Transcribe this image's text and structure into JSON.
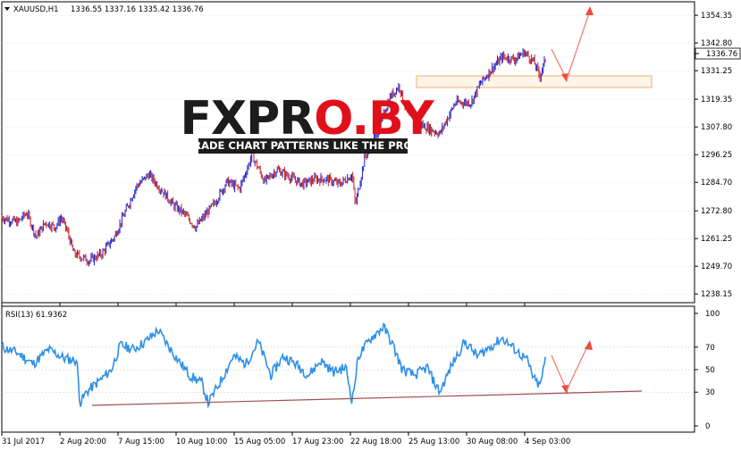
{
  "header": {
    "symbol": "XAUUSD,H1",
    "ohlc": "1336.55 1337.16 1335.42 1336.76",
    "current_price": "1336.76"
  },
  "watermark": {
    "name": "FXPRO.BY",
    "tagline": "TRADE CHART PATTERNS LIKE THE PROS"
  },
  "chart_data": [
    {
      "type": "candlestick",
      "title": "XAUUSD,H1",
      "ylim": [
        1236,
        1357
      ],
      "y_ticks": [
        "1354.35",
        "1342.80",
        "1331.25",
        "1319.35",
        "1307.80",
        "1296.25",
        "1284.70",
        "1272.80",
        "1261.25",
        "1249.70",
        "1238.15"
      ],
      "x_ticks": [
        "31 Jul 2017",
        "2 Aug 20:00",
        "7 Aug 15:00",
        "10 Aug 10:00",
        "15 Aug 05:00",
        "17 Aug 23:00",
        "22 Aug 18:00",
        "25 Aug 13:00",
        "30 Aug 08:00",
        "4 Sep 03:00"
      ],
      "close_path": [
        [
          0,
          1270
        ],
        [
          0.05,
          1268
        ],
        [
          0.08,
          1272
        ],
        [
          0.11,
          1262
        ],
        [
          0.14,
          1268
        ],
        [
          0.17,
          1266
        ],
        [
          0.19,
          1270
        ],
        [
          0.21,
          1264
        ],
        [
          0.23,
          1255
        ],
        [
          0.28,
          1252
        ],
        [
          0.32,
          1255
        ],
        [
          0.36,
          1262
        ],
        [
          0.4,
          1274
        ],
        [
          0.43,
          1283
        ],
        [
          0.47,
          1288
        ],
        [
          0.52,
          1280
        ],
        [
          0.55,
          1275
        ],
        [
          0.58,
          1272
        ],
        [
          0.62,
          1266
        ],
        [
          0.68,
          1276
        ],
        [
          0.72,
          1285
        ],
        [
          0.76,
          1282
        ],
        [
          0.8,
          1296
        ],
        [
          0.84,
          1285
        ],
        [
          0.88,
          1290
        ],
        [
          0.92,
          1287
        ],
        [
          0.96,
          1284
        ],
        [
          1.0,
          1286
        ],
        [
          1.04,
          1286
        ],
        [
          1.08,
          1284
        ],
        [
          1.12,
          1288
        ],
        [
          1.13,
          1275
        ],
        [
          1.16,
          1295
        ],
        [
          1.2,
          1305
        ],
        [
          1.24,
          1320
        ],
        [
          1.27,
          1325
        ],
        [
          1.3,
          1312
        ],
        [
          1.35,
          1308
        ],
        [
          1.4,
          1305
        ],
        [
          1.45,
          1318
        ],
        [
          1.5,
          1318
        ],
        [
          1.53,
          1326
        ],
        [
          1.56,
          1331
        ],
        [
          1.6,
          1337
        ],
        [
          1.64,
          1336
        ],
        [
          1.67,
          1339
        ],
        [
          1.7,
          1335
        ],
        [
          1.72,
          1329
        ],
        [
          1.74,
          1337
        ]
      ],
      "annotations": {
        "zone_price_range": [
          1323.5,
          1326.5
        ],
        "arrow_down_to": 1325,
        "arrow_up_to": 1354
      }
    },
    {
      "type": "line",
      "title": "RSI(13) 61.9362",
      "series": [
        {
          "name": "RSI(13)",
          "values": []
        }
      ],
      "ylim": [
        0,
        100
      ],
      "y_ticks": [
        "100",
        "70",
        "50",
        "30",
        "0"
      ],
      "rsi_path": [
        [
          0,
          70
        ],
        [
          0.05,
          65
        ],
        [
          0.1,
          55
        ],
        [
          0.15,
          68
        ],
        [
          0.2,
          60
        ],
        [
          0.24,
          58
        ],
        [
          0.25,
          20
        ],
        [
          0.27,
          30
        ],
        [
          0.32,
          42
        ],
        [
          0.35,
          50
        ],
        [
          0.38,
          72
        ],
        [
          0.42,
          68
        ],
        [
          0.46,
          75
        ],
        [
          0.5,
          85
        ],
        [
          0.53,
          72
        ],
        [
          0.56,
          60
        ],
        [
          0.6,
          45
        ],
        [
          0.64,
          38
        ],
        [
          0.66,
          20
        ],
        [
          0.7,
          40
        ],
        [
          0.74,
          62
        ],
        [
          0.78,
          55
        ],
        [
          0.82,
          75
        ],
        [
          0.86,
          45
        ],
        [
          0.9,
          62
        ],
        [
          0.94,
          55
        ],
        [
          0.98,
          45
        ],
        [
          1.02,
          58
        ],
        [
          1.06,
          48
        ],
        [
          1.1,
          52
        ],
        [
          1.12,
          22
        ],
        [
          1.14,
          62
        ],
        [
          1.18,
          78
        ],
        [
          1.22,
          88
        ],
        [
          1.25,
          72
        ],
        [
          1.28,
          50
        ],
        [
          1.32,
          45
        ],
        [
          1.36,
          52
        ],
        [
          1.38,
          40
        ],
        [
          1.4,
          30
        ],
        [
          1.44,
          55
        ],
        [
          1.48,
          75
        ],
        [
          1.52,
          62
        ],
        [
          1.56,
          70
        ],
        [
          1.6,
          78
        ],
        [
          1.64,
          68
        ],
        [
          1.68,
          58
        ],
        [
          1.7,
          42
        ],
        [
          1.72,
          35
        ],
        [
          1.74,
          62
        ]
      ],
      "annotations": {
        "trendline_from": [
          0.25,
          20
        ],
        "trendline_to": [
          1.95,
          30
        ],
        "arrow_down_to": 30,
        "arrow_up_to": 68
      }
    }
  ],
  "colors": {
    "up_candle": "#2020c8",
    "down_candle": "#cc2020",
    "rsi_line": "#2e8fe6",
    "trendline": "#a05050",
    "arrow": "#f08070",
    "zone_border": "#f5c89a",
    "zone_fill": "#fdf4ea",
    "grid": "#c8c8c8",
    "logo_dark": "#1c1c1c",
    "logo_red": "#e0101a"
  }
}
